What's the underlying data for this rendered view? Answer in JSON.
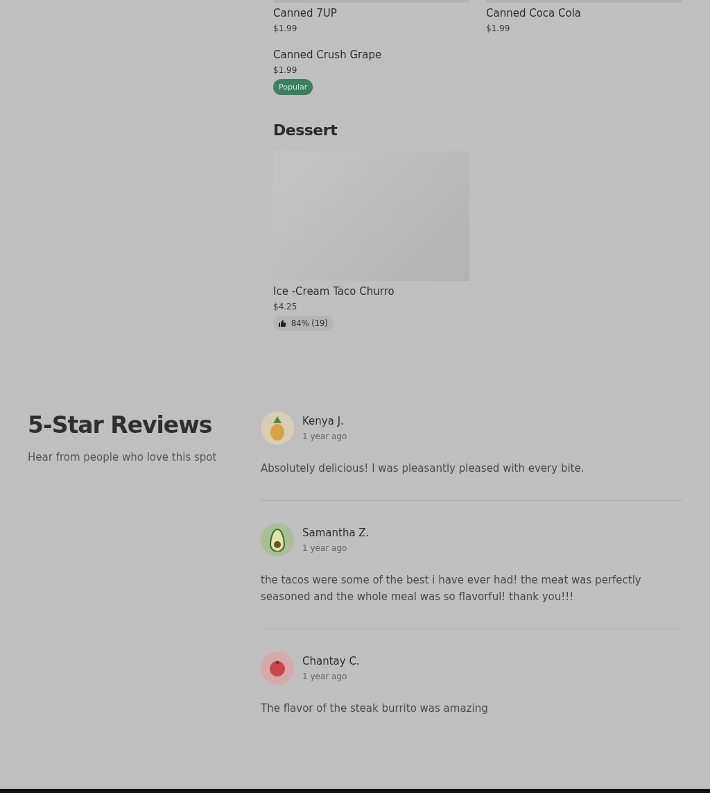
{
  "menu_sections": [
    {
      "items": [
        {
          "name": "Canned 7UP",
          "price": "$1.99",
          "kind": "cut"
        },
        {
          "name": "Canned Coca Cola",
          "price": "$1.99",
          "kind": "cut"
        },
        {
          "name": "Canned Crush Grape",
          "price": "$1.99",
          "badge": "Popular"
        }
      ]
    },
    {
      "title": "Dessert",
      "items": [
        {
          "name": "Ice -Cream Taco Churro",
          "price": "$4.25",
          "kind": "placeholder",
          "rating": "84% (19)"
        }
      ]
    }
  ],
  "reviews_section": {
    "title": "5-Star Reviews",
    "subtitle": "Hear from people who love this spot",
    "reviews": [
      {
        "name": "Kenya J.",
        "time": "1 year ago",
        "text": "Absolutely delicious! I was pleasantly pleased with every bite.",
        "color": "#d9cdb4"
      },
      {
        "name": "Samantha Z.",
        "time": "1 year ago",
        "text": "the tacos were some of the best i have ever had! the meat was perfectly seasoned and the whole meal was so flavorful! thank you!!!",
        "color": "#a9bf98"
      },
      {
        "name": "Chantay C.",
        "time": "1 year ago",
        "text": "The flavor of the steak burrito was amazing",
        "color": "#d7a9a9"
      }
    ]
  }
}
